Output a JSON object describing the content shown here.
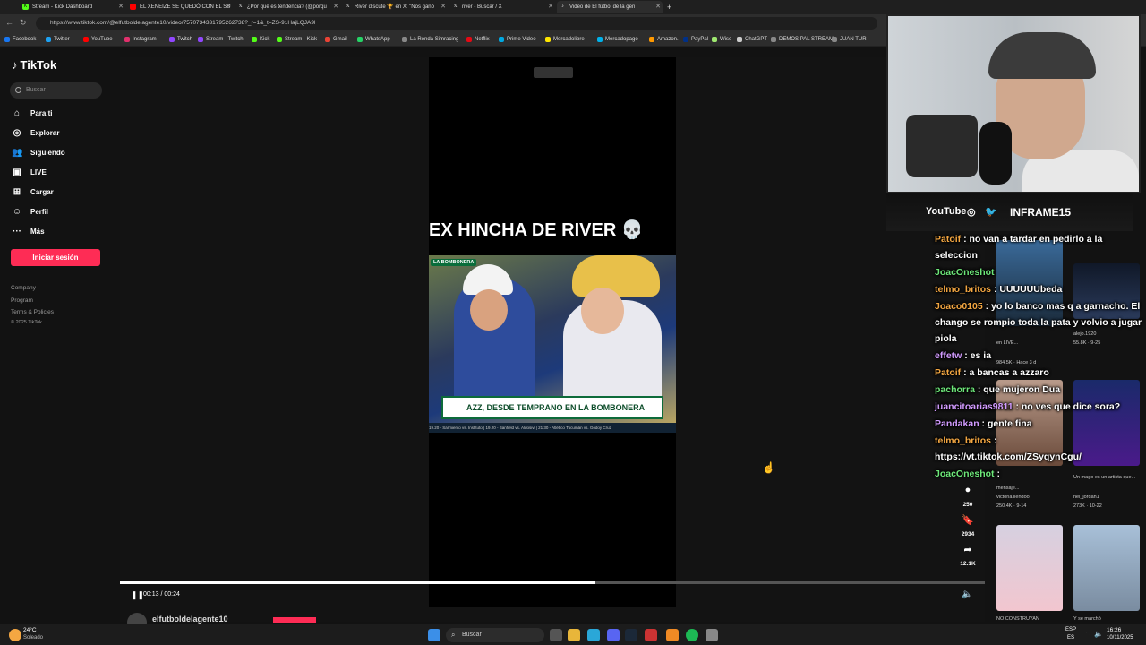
{
  "browser": {
    "tabs": [
      {
        "label": "Stream - Kick Dashboard",
        "color": "#53fc18"
      },
      {
        "label": "EL XENEIZE SE QUEDÓ CON EL SU",
        "color": "#ff0000"
      },
      {
        "label": "¿Por qué es tendencia? (@porqu",
        "color": "#ffffff"
      },
      {
        "label": "River discute 🏆 en X: \"Nos ganó",
        "color": "#ffffff"
      },
      {
        "label": "river - Buscar / X",
        "color": "#ffffff"
      },
      {
        "label": "Video de El fútbol de la gen",
        "color": "#ffffff"
      }
    ],
    "url": "https://www.tiktok.com/@elfutboldelagente10/video/7570734331795262738?_r=1&_t=ZS-91HajLQJA9l",
    "bookmarks": [
      "Facebook",
      "Twitter",
      "YouTube",
      "Instagram",
      "Twitch",
      "Stream - Twitch",
      "Kick",
      "Stream - Kick",
      "Gmail",
      "WhatsApp",
      "La Ronda Simracing",
      "Netflix",
      "Prime Video",
      "Mercadolibre",
      "Mercadopago",
      "Amazon.",
      "PayPal",
      "Wise",
      "ChatGPT",
      "DEMOS PAL STREAM",
      "JUAN TUR"
    ]
  },
  "tiktok": {
    "logo": "TikTok",
    "search_placeholder": "Buscar",
    "nav": [
      {
        "label": "Para ti",
        "icon": "home-icon"
      },
      {
        "label": "Explorar",
        "icon": "compass-icon"
      },
      {
        "label": "Siguiendo",
        "icon": "following-icon"
      },
      {
        "label": "LIVE",
        "icon": "live-icon"
      },
      {
        "label": "Cargar",
        "icon": "upload-icon"
      },
      {
        "label": "Perfil",
        "icon": "profile-icon"
      },
      {
        "label": "Más",
        "icon": "more-icon"
      }
    ],
    "login": "Iniciar sesión",
    "footer": [
      "Company",
      "Program",
      "Terms & Policies",
      "© 2025 TikTok"
    ],
    "accent": "#fe2c55"
  },
  "video": {
    "caption": "EX HINCHA DE RIVER 💀",
    "tag": "LA BOMBONERA",
    "lower_third": "AZZ, DESDE TEMPRANO EN LA BOMBONERA",
    "ticker": "19.20 - Sarmiento vs. Instituto | 19.20 - Banfield vs. Aldosivi | 21.30 - Atlético Tucumán vs. Godoy Cruz",
    "time": "00:13 / 00:24",
    "progress": 0.55,
    "author": "elfutboldelagente10"
  },
  "actions": {
    "comments": "250",
    "saves": "2934",
    "shares": "12.1K"
  },
  "stream": {
    "brand": "INFRAME15",
    "youtube": "YouTube"
  },
  "related": [
    {
      "title": "Polémica",
      "subtitle": "en LIVE...",
      "stats": "984.5K · Hace 3 d"
    },
    {
      "title": "alejo.1920",
      "stats": "55.8K · 9-25"
    },
    {
      "title": "mensaje...",
      "author": "victoria.liendoo",
      "stats": "250.4K · 9-14"
    },
    {
      "title": "Un mago es un artista que...",
      "author": "nel_jordan1",
      "stats": "273K · 10-22"
    },
    {
      "title": "NO CONSTRUYAN",
      "stats": ""
    },
    {
      "title": "Y se marchó",
      "stats": ""
    }
  ],
  "chat": [
    {
      "user": "Patoif",
      "color": "#f4a742",
      "text": ": no van a tardar en pedirlo a la seleccion"
    },
    {
      "user": "JoacOneshot",
      "color": "#6ee87a",
      "text": ""
    },
    {
      "user": "telmo_britos",
      "color": "#f4a742",
      "text": ": UUUUUUbeda"
    },
    {
      "user": "Joaco0105",
      "color": "#f4a742",
      "text": ": yo lo banco mas q a garnacho. El chango se rompio toda la pata y volvio a jugar piola"
    },
    {
      "user": "effetw",
      "color": "#d29bff",
      "text": ": es ia"
    },
    {
      "user": "Patoif",
      "color": "#f4a742",
      "text": ": a bancas a azzaro"
    },
    {
      "user": "pachorra",
      "color": "#6ee87a",
      "text": ": que mujeron Dua"
    },
    {
      "user": "juancitoarias9811",
      "color": "#d29bff",
      "text": ": no ves que dice sora?"
    },
    {
      "user": "Pandakan",
      "color": "#d29bff",
      "text": ": gente fina"
    },
    {
      "user": "telmo_britos",
      "color": "#f4a742",
      "text": ": https://vt.tiktok.com/ZSyqynCgu/"
    },
    {
      "user": "JoacOneshot",
      "color": "#6ee87a",
      "text": ":"
    }
  ],
  "taskbar": {
    "weather_temp": "24°C",
    "weather_desc": "Soleado",
    "search": "Buscar",
    "lang": "ESP",
    "lang2": "ES",
    "time": "16:26",
    "date": "10/11/2025"
  }
}
